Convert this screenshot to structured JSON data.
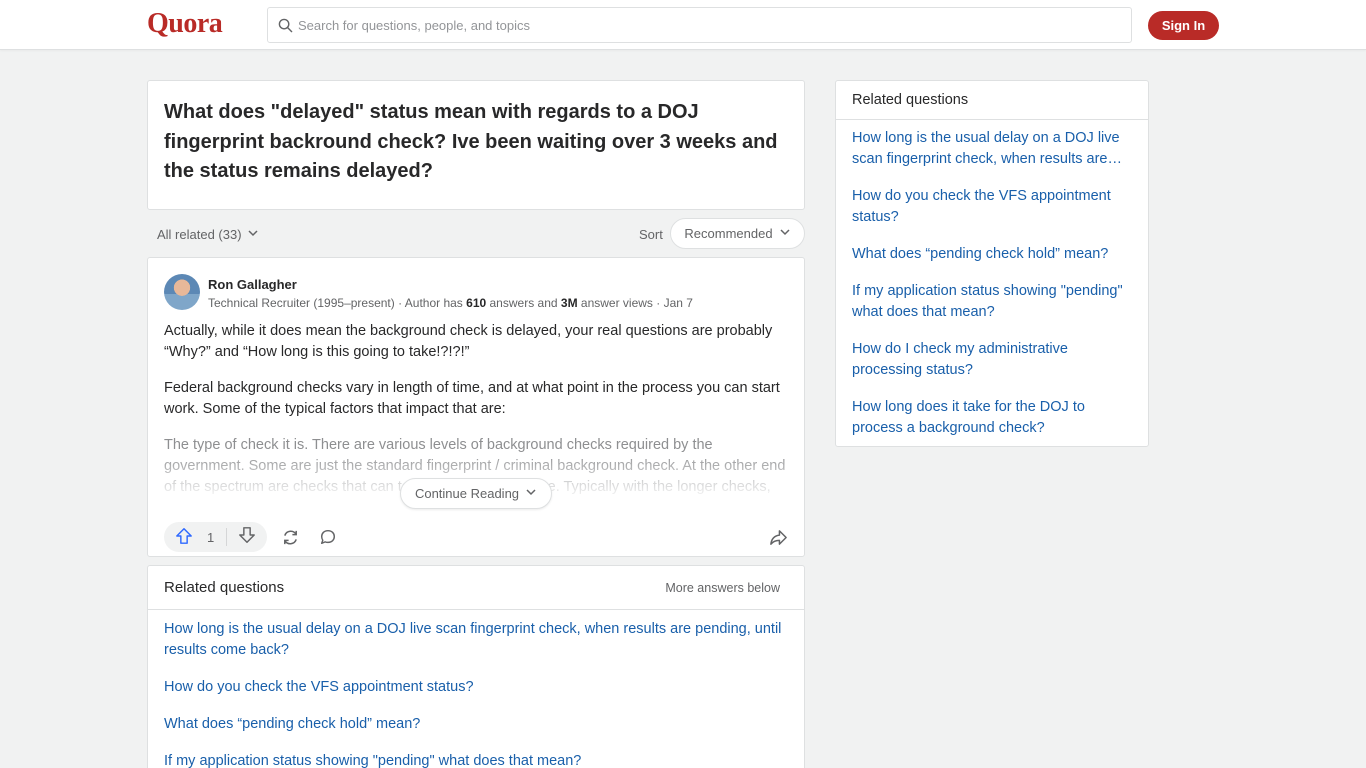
{
  "header": {
    "logo": "Quora",
    "search_placeholder": "Search for questions, people, and topics",
    "signin_label": "Sign In"
  },
  "question": {
    "title": "What does \"delayed\" status mean with regards to a DOJ fingerprint backround check? Ive been waiting over 3 weeks and the status remains delayed?"
  },
  "meta": {
    "all_related": "All related (33)",
    "sort_label": "Sort",
    "sort_value": "Recommended"
  },
  "answer": {
    "author_name": "Ron Gallagher",
    "cred_prefix": "Technical Recruiter (1995–present) · Author has ",
    "answers_count": "610",
    "cred_mid": " answers and ",
    "views_count": "3M",
    "cred_suffix": " answer views · Jan 7",
    "paragraphs": [
      "Actually, while it does mean the background check is delayed, your real questions are probably “Why?” and “How long is this going to take!?!?!”",
      "Federal background checks vary in length of time, and at what point in the process you can start work. Some of the typical factors that impact that are:",
      "The type of check it is. There are various levels of background checks required by the government. Some are just the standard fingerprint / criminal background check. At the other end of the spectrum are checks that can take months to complete. Typically with the longer checks, you clear a certain"
    ],
    "continue_label": "Continue Reading",
    "upvote_count": "1"
  },
  "related_main": {
    "title": "Related questions",
    "more_answers": "More answers below",
    "items": [
      "How long is the usual delay on a DOJ live scan fingerprint check, when results are pending, until results come back?",
      "How do you check the VFS appointment status?",
      "What does “pending check hold” mean?",
      "If my application status showing \"pending\" what does that mean?"
    ]
  },
  "related_side": {
    "title": "Related questions",
    "items": [
      "How long is the usual delay on a DOJ live scan fingerprint check, when results are pending, until results come back?",
      "How do you check the VFS appointment status?",
      "What does “pending check hold” mean?",
      "If my application status showing \"pending\" what does that mean?",
      "How do I check my administrative processing status?",
      "How long does it take for the DOJ to process a background check?"
    ]
  },
  "colors": {
    "brand": "#b92b27",
    "link": "#195faa",
    "upvote": "#2e69ff"
  }
}
